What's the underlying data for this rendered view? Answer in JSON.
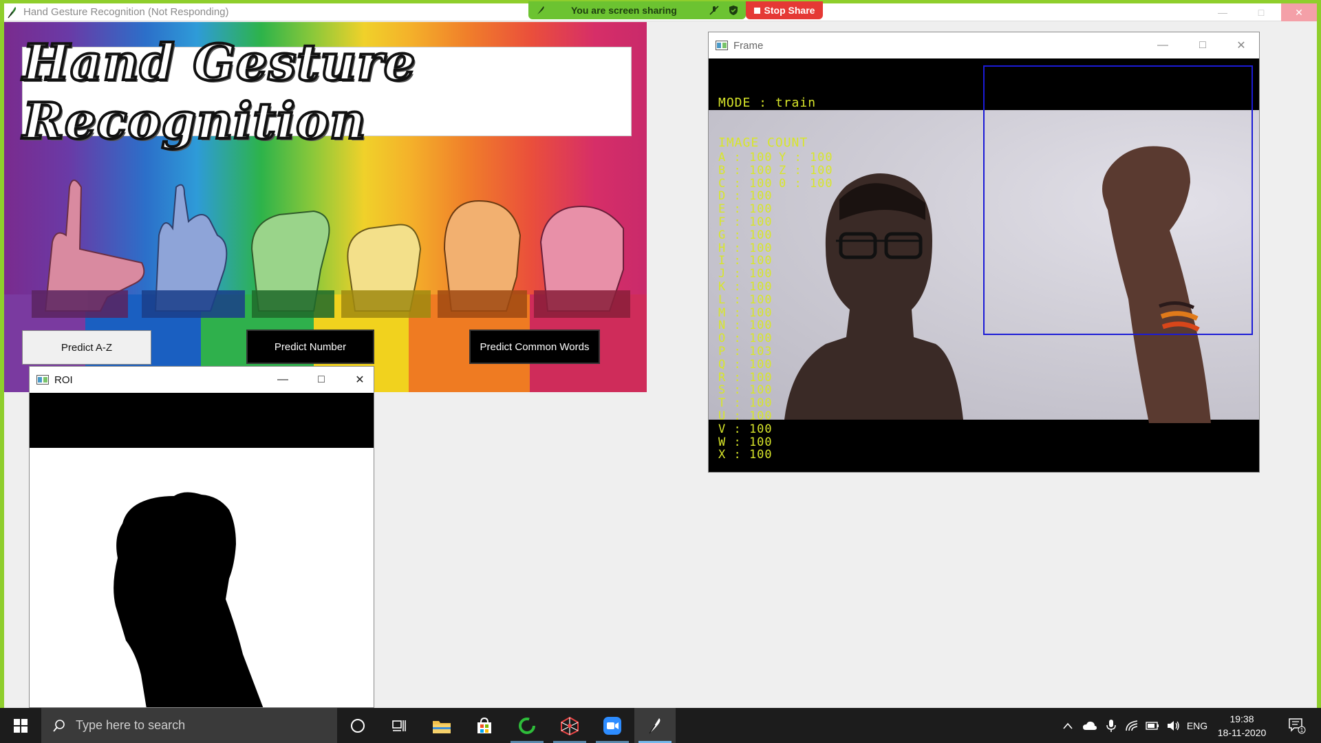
{
  "app": {
    "window_title": "Hand Gesture Recognition (Not Responding)",
    "banner_title": "Hand Gesture Recognition"
  },
  "screen_share": {
    "status_text": "You are screen sharing",
    "stop_label": "Stop Share"
  },
  "buttons": {
    "predict_az": "Predict A-Z",
    "predict_number": "Predict Number",
    "predict_words": "Predict Common Words"
  },
  "roi_window": {
    "title": "ROI"
  },
  "frame_window": {
    "title": "Frame",
    "mode_text": "MODE : train",
    "image_count_heading": "IMAGE COUNT",
    "counts_col1": [
      "A : 100",
      "B : 100",
      "C : 100",
      "D : 100",
      "E : 100",
      "F : 100",
      "G : 100",
      "H : 100",
      "I : 100",
      "J : 100",
      "K : 100",
      "L : 100",
      "M : 100",
      "N : 100",
      "O : 100",
      "P : 103",
      "Q : 100",
      "R : 100",
      "S : 100",
      "T : 100",
      "U : 100",
      "V : 100",
      "W : 100",
      "X : 100"
    ],
    "counts_col2": [
      "Y : 100",
      "Z : 100",
      "0 : 100"
    ]
  },
  "taskbar": {
    "search_placeholder": "Type here to search",
    "language": "ENG",
    "time": "19:38",
    "date": "18-11-2020",
    "notification_count": "1",
    "icons": [
      "windows-start-icon",
      "search-icon",
      "cortana-icon",
      "task-view-icon",
      "file-explorer-icon",
      "microsoft-store-icon",
      "loading-ring-app-icon",
      "spider-web-app-icon",
      "zoom-icon",
      "feather-app-icon"
    ]
  },
  "colors": {
    "share_green": "#8fce2c",
    "stop_red": "#e53935",
    "overlay_text": "#d8e62a",
    "roi_box": "#1b1bd6",
    "taskbar": "#1c1c1c"
  }
}
